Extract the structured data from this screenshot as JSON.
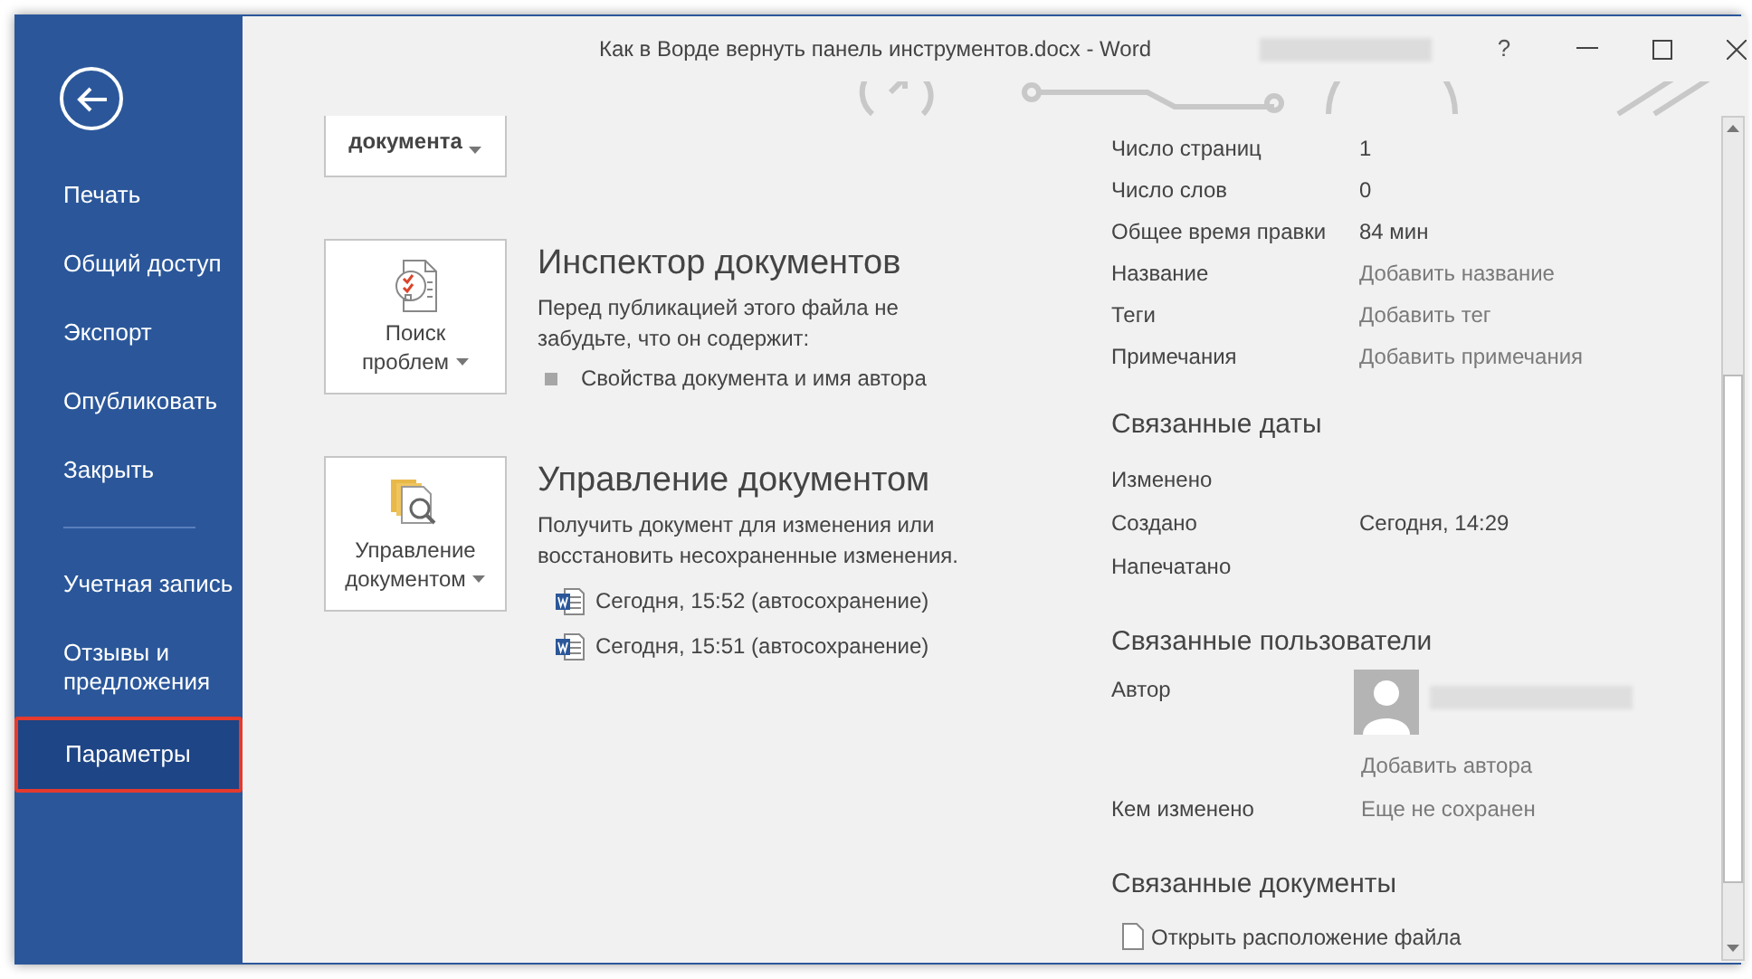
{
  "window": {
    "title": "Как в Ворде вернуть панель инструментов.docx  -  Word",
    "controls": [
      "?"
    ]
  },
  "sidebar": {
    "groups": [
      [
        {
          "label": "Печать",
          "selected": false
        },
        {
          "label": "Общий доступ",
          "selected": false
        },
        {
          "label": "Экспорт",
          "selected": false
        },
        {
          "label": "Опубликовать",
          "selected": false
        },
        {
          "label": "Закрыть",
          "selected": false
        }
      ],
      [
        {
          "label": "Учетная запись",
          "selected": false
        },
        {
          "label": "Отзывы и предложения",
          "selected": false
        },
        {
          "label": "Параметры",
          "selected": true
        }
      ]
    ]
  },
  "top_card": {
    "label": "документа"
  },
  "sections": [
    {
      "button": [
        "Поиск",
        "проблем"
      ],
      "kind": "inspect",
      "title": "Инспектор документов",
      "text": "Перед публикацией этого файла не забудьте, что он содержит:",
      "items": [
        {
          "kind": "bullet",
          "label": "Свойства документа и имя автора"
        }
      ]
    },
    {
      "button": [
        "Управление",
        "документом"
      ],
      "kind": "manage",
      "title": "Управление документом",
      "text": "Получить документ для изменения или восстановить несохраненные изменения.",
      "items": [
        {
          "kind": "word",
          "label": "Сегодня, 15:52 (автосохранение)"
        },
        {
          "kind": "word",
          "label": "Сегодня, 15:51 (автосохранение)"
        }
      ]
    }
  ],
  "properties": [
    {
      "label": "Число страниц",
      "value": "1"
    },
    {
      "label": "Число слов",
      "value": "0"
    },
    {
      "label": "Общее время правки",
      "value": "84 мин"
    },
    {
      "label": "Название",
      "placeholder": "Добавить название"
    },
    {
      "label": "Теги",
      "placeholder": "Добавить тег"
    },
    {
      "label": "Примечания",
      "placeholder": "Добавить примечания"
    }
  ],
  "related_dates": {
    "title": "Связанные даты",
    "rows": [
      {
        "label": "Изменено"
      },
      {
        "label": "Создано",
        "value": "Сегодня, 14:29"
      },
      {
        "label": "Напечатано"
      }
    ]
  },
  "related_people": {
    "title": "Связанные пользователи",
    "author_label": "Автор",
    "add_author": "Добавить автора",
    "modified_by_label": "Кем изменено",
    "modified_by": "Еще не сохранен"
  },
  "related_documents": {
    "title": "Связанные документы",
    "open_location": "Открыть расположение файла"
  }
}
